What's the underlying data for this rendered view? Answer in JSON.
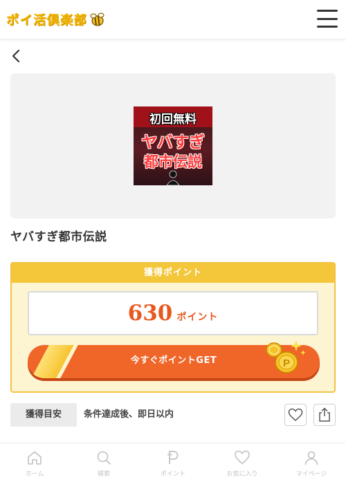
{
  "header": {
    "logo_text": "ポイ活倶楽部",
    "logo_icon": "bee-icon",
    "menu_icon": "hamburger-menu-icon"
  },
  "back_icon": "chevron-left-icon",
  "hero": {
    "thumbnail": {
      "line1": "初回無料",
      "line2": "ヤバすぎ",
      "line3": "都市伝説"
    }
  },
  "title": "ヤバすぎ都市伝説",
  "points": {
    "heading": "獲得ポイント",
    "value": "630",
    "unit": "ポイント",
    "cta_label": "今すぐポイントGET",
    "colors": {
      "accent": "#f06528",
      "points_text": "#e8581e",
      "box_border": "#f3c242",
      "box_bg": "#fdf4d2"
    }
  },
  "estimate": {
    "label": "獲得目安",
    "value": "条件達成後、即日以内",
    "fav_icon": "heart-icon",
    "share_icon": "share-icon"
  },
  "bottom_nav": {
    "items": [
      {
        "label": "ホーム",
        "icon": "home-icon"
      },
      {
        "label": "検索",
        "icon": "search-icon"
      },
      {
        "label": "ポイント",
        "icon": "point-p-icon"
      },
      {
        "label": "お気に入り",
        "icon": "heart-icon"
      },
      {
        "label": "マイページ",
        "icon": "user-icon"
      }
    ]
  }
}
